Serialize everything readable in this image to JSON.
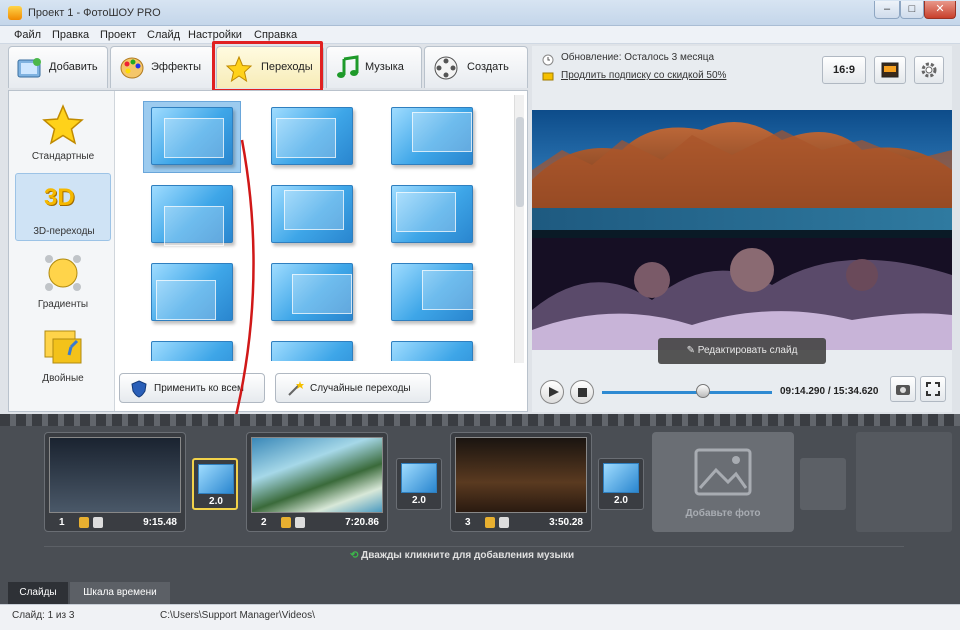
{
  "window": {
    "title": "Проект 1 - ФотоШОУ PRO",
    "minimize": "–",
    "maximize": "□",
    "close": "✕"
  },
  "menu": [
    "Файл",
    "Правка",
    "Проект",
    "Слайд",
    "Настройки",
    "Справка"
  ],
  "tabs": [
    {
      "label": "Добавить",
      "icon": "add-photo-icon"
    },
    {
      "label": "Эффекты",
      "icon": "palette-icon"
    },
    {
      "label": "Переходы",
      "icon": "star-icon"
    },
    {
      "label": "Музыка",
      "icon": "music-note-icon"
    },
    {
      "label": "Создать",
      "icon": "film-reel-icon"
    }
  ],
  "categories": [
    {
      "label": "Стандартные",
      "icon": "star-icon"
    },
    {
      "label": "3D-переходы",
      "icon": "3d-icon",
      "badge": "3D"
    },
    {
      "label": "Градиенты",
      "icon": "gradient-icon"
    },
    {
      "label": "Двойные",
      "icon": "double-icon"
    }
  ],
  "actions": {
    "apply_all": "Применить ко всем",
    "random": "Случайные переходы"
  },
  "promo": {
    "line1": "Обновление: Осталось 3 месяца",
    "line2": "Продлить подписку со скидкой 50%"
  },
  "view": {
    "aspect": "16:9"
  },
  "preview": {
    "edit_label": "Редактировать слайд",
    "time": "09:14.290 / 15:34.620"
  },
  "timeline": {
    "slides": [
      {
        "num": "1",
        "duration": "9:15.48"
      },
      {
        "num": "2",
        "duration": "7:20.86"
      },
      {
        "num": "3",
        "duration": "3:50.28"
      }
    ],
    "transitions": [
      {
        "duration": "2.0"
      },
      {
        "duration": "2.0"
      },
      {
        "duration": "2.0"
      }
    ],
    "add_photo": "Добавьте фото",
    "music_hint": "Дважды кликните для добавления музыки"
  },
  "bottom_tabs": [
    "Слайды",
    "Шкала времени"
  ],
  "status": {
    "slide": "Слайд: 1 из 3",
    "path": "C:\\Users\\Support Manager\\Videos\\"
  },
  "colors": {
    "accent_blue": "#2e8ad2",
    "highlight_red": "#e02020",
    "selection_yellow": "#f2d24a"
  }
}
